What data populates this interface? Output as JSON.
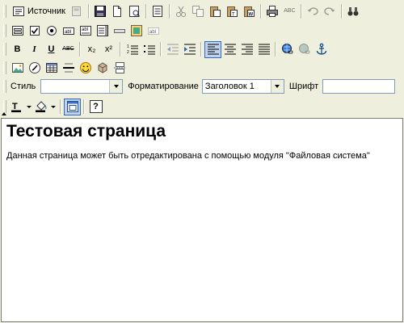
{
  "toolbar": {
    "source_label": "Источник",
    "bold_label": "B",
    "italic_label": "I",
    "underline_label": "U",
    "strike_label": "ABC",
    "subscript_label": "x₂",
    "superscript_label": "x²",
    "spell_label": "ABC",
    "style_label": "Стиль",
    "style_value": "",
    "format_label": "Форматирование",
    "format_value": "Заголовок 1",
    "font_label": "Шрифт",
    "font_value": "",
    "text_color_label": "T",
    "help_label": "?"
  },
  "editor": {
    "heading": "Тестовая страница",
    "body": "Данная страница может быть отредактирована с помощью модуля \"Файловая система\""
  },
  "colors": {
    "toolbar_bg": "#efefde",
    "pressed_bg": "#c1d2ee",
    "pressed_border": "#316ac5"
  }
}
